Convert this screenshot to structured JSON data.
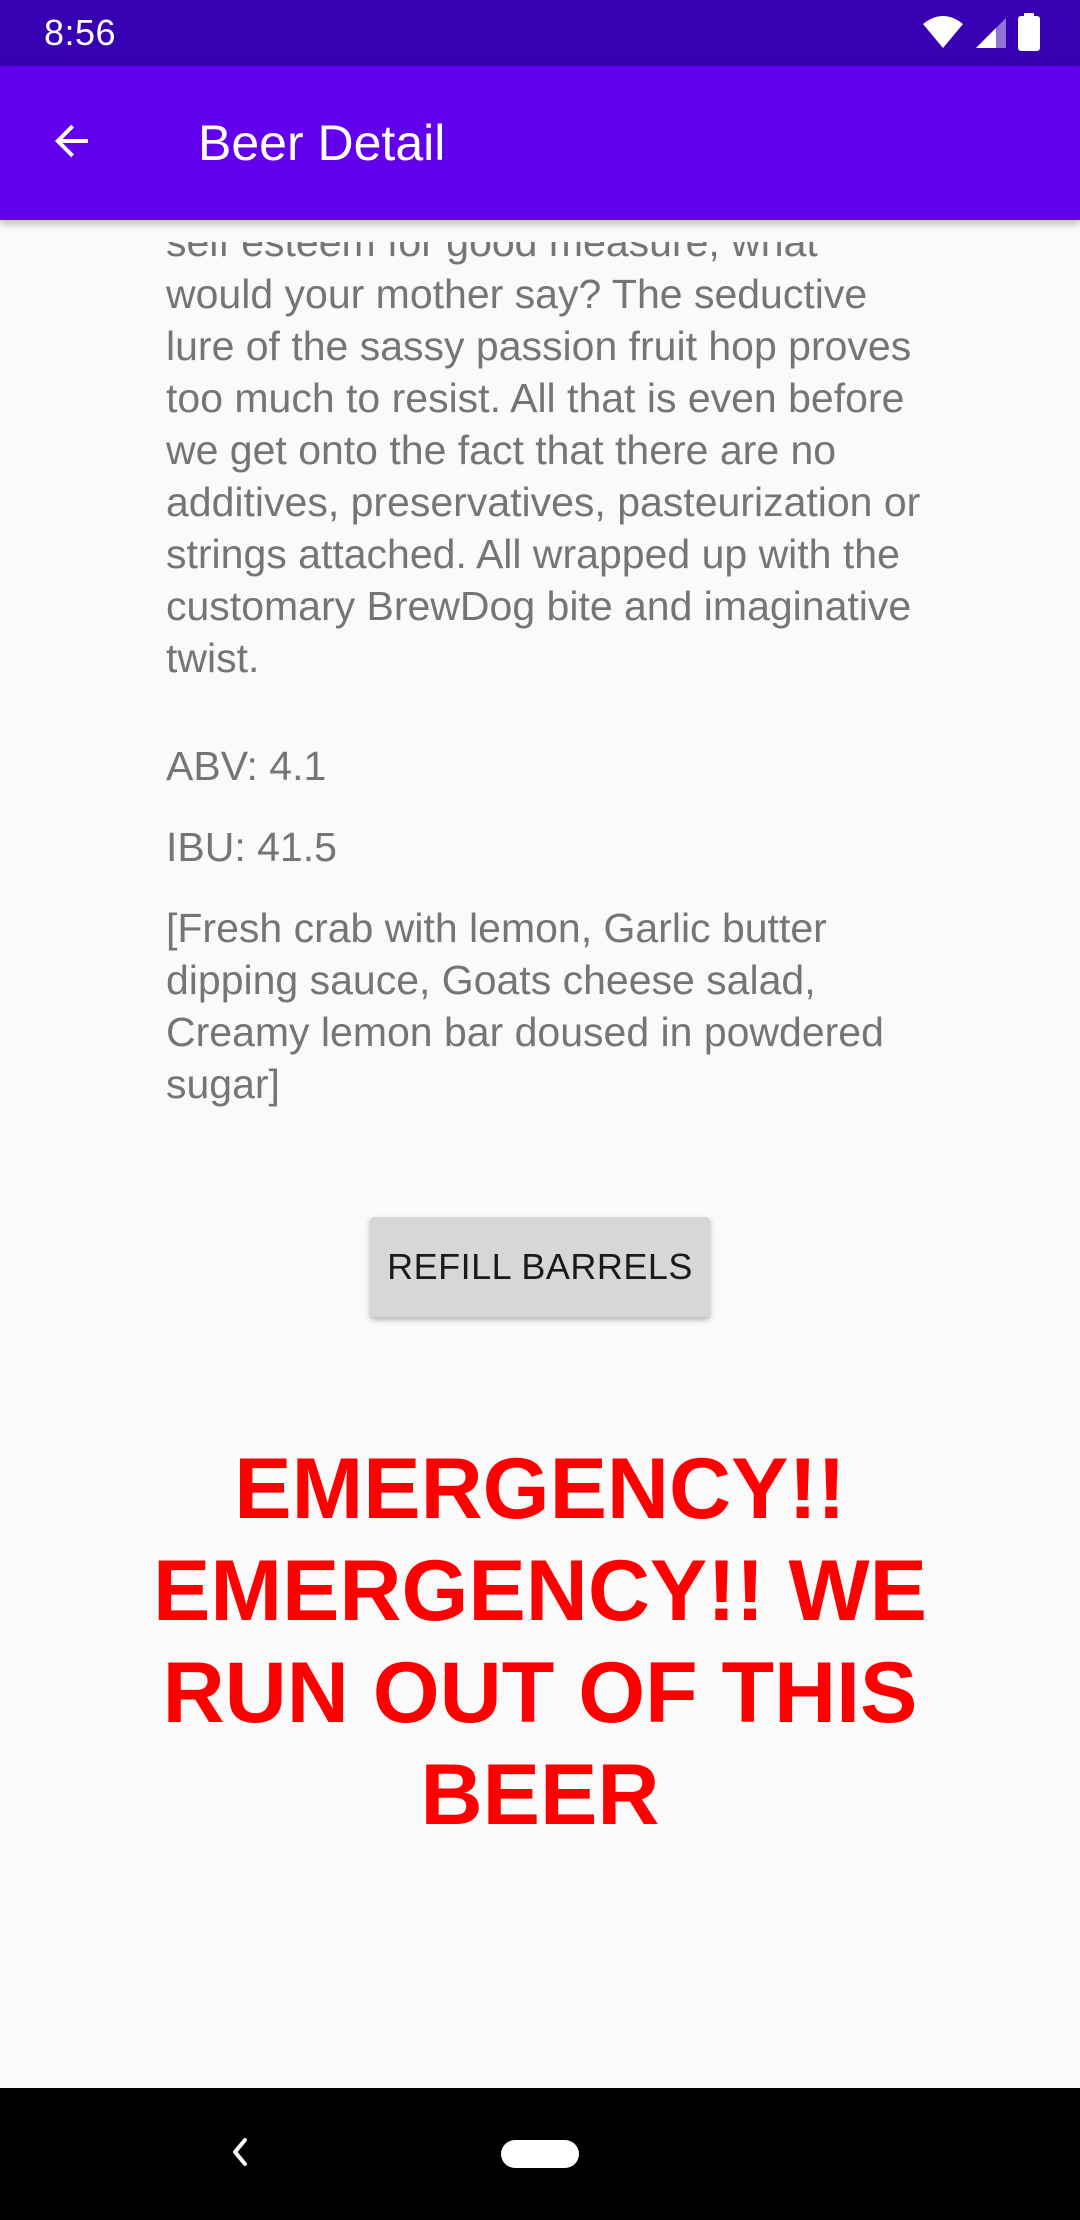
{
  "status_bar": {
    "time": "8:56",
    "icons": [
      "wifi-icon",
      "cell-signal-icon",
      "battery-icon"
    ]
  },
  "app_bar": {
    "back_icon": "arrow-back-icon",
    "title": "Beer Detail"
  },
  "beer": {
    "description_visible": "self esteem for good measure; what would your mother say? The seductive lure of the sassy passion fruit hop proves too much to resist. All that is even before we get onto the fact that there are no additives, preservatives, pasteurization or strings attached. All wrapped up with the customary BrewDog bite and imaginative twist.",
    "abv": "ABV: 4.1",
    "ibu": "IBU: 41.5",
    "food_pairing": "[Fresh crab with lemon, Garlic butter dipping sauce, Goats cheese salad, Creamy lemon bar doused in powdered sugar]"
  },
  "actions": {
    "refill_label": "REFILL BARRELS"
  },
  "alert": {
    "message": "EMERGENCY!! EMERGENCY!! WE RUN OUT OF THIS BEER",
    "color": "#ff0000"
  },
  "nav_bar": {
    "back_icon": "nav-back-icon",
    "home_icon": "home-pill-icon"
  },
  "colors": {
    "status_bar": "#3700b3",
    "app_bar": "#6200ee",
    "background": "#fafafa",
    "body_text": "#757575",
    "button": "#d6d7d7"
  }
}
